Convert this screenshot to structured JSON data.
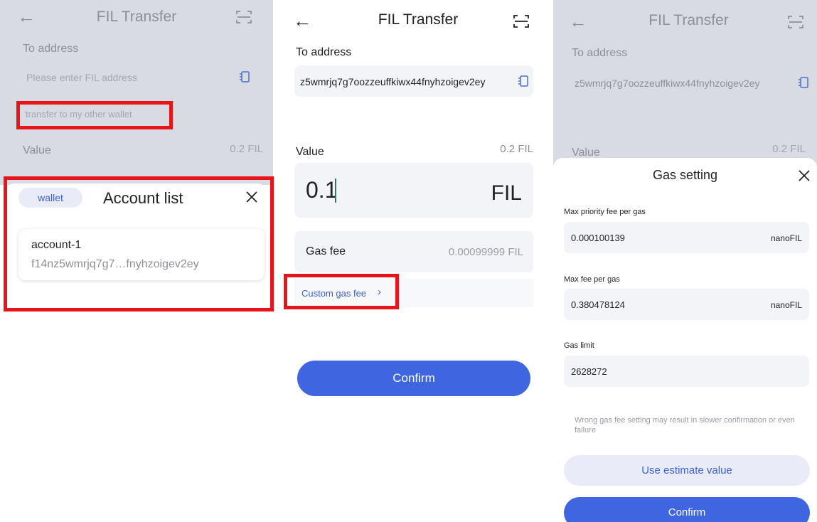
{
  "panel1": {
    "title": "FIL Transfer",
    "to_address_label": "To address",
    "address_placeholder": "Please enter FIL address",
    "memo_placeholder": "transfer to my other wallet",
    "value_label": "Value",
    "balance": "0.2 FIL",
    "sheet": {
      "tab_label": "wallet",
      "title": "Account list",
      "account_name": "account-1",
      "account_address": "f14nz5wmrjq7g7…fnyhzoigev2ey"
    }
  },
  "panel2": {
    "title": "FIL Transfer",
    "to_address_label": "To address",
    "address_value": "z5wmrjq7g7oozzeuffkiwx44fnyhzoigev2ey",
    "value_label": "Value",
    "balance": "0.2 FIL",
    "amount": "0.1",
    "unit": "FIL",
    "gas_fee_label": "Gas fee",
    "gas_fee_value": "0.00099999 FIL",
    "custom_gas_label": "Custom gas fee",
    "confirm_label": "Confirm"
  },
  "panel3": {
    "title": "FIL Transfer",
    "to_address_label": "To address",
    "address_value": "z5wmrjq7g7oozzeuffkiwx44fnyhzoigev2ey",
    "value_label": "Value",
    "balance": "0.2 FIL",
    "sheet": {
      "title": "Gas setting",
      "priority_label": "Max priority fee per gas",
      "priority_value": "0.000100139",
      "priority_unit": "nanoFIL",
      "max_fee_label": "Max fee per gas",
      "max_fee_value": "0.380478124",
      "max_fee_unit": "nanoFIL",
      "gas_limit_label": "Gas limit",
      "gas_limit_value": "2628272",
      "warning": "Wrong gas fee setting may result in slower confirmation or even failure",
      "estimate_label": "Use estimate value",
      "confirm_label": "Confirm"
    }
  },
  "colors": {
    "primary": "#3f66e0",
    "highlight": "#e8141a",
    "overlay": "#d9dbe3",
    "field_bg": "#f3f4f7"
  },
  "icons": [
    "arrow-left-icon",
    "scan-icon",
    "address-book-icon",
    "close-icon",
    "chevron-right-icon"
  ]
}
